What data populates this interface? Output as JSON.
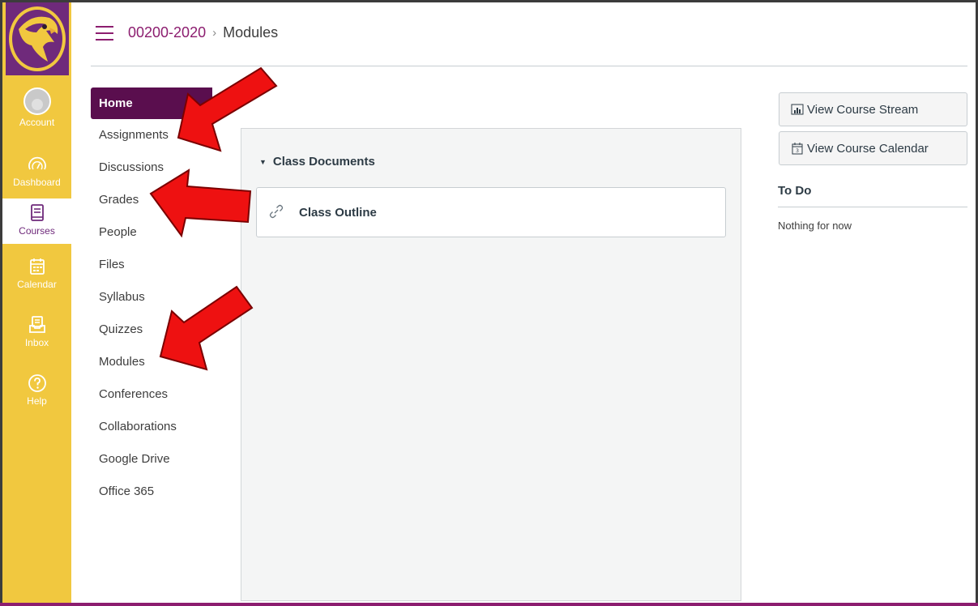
{
  "global_nav": {
    "items": [
      {
        "label": "Account",
        "icon": "avatar"
      },
      {
        "label": "Dashboard",
        "icon": "dashboard-icon"
      },
      {
        "label": "Courses",
        "icon": "courses-icon"
      },
      {
        "label": "Calendar",
        "icon": "calendar-icon"
      },
      {
        "label": "Inbox",
        "icon": "inbox-icon"
      },
      {
        "label": "Help",
        "icon": "help-icon"
      }
    ],
    "active": "Courses"
  },
  "header": {
    "course": "00200-2020",
    "separator": "›",
    "current": "Modules"
  },
  "course_nav": {
    "items": [
      "Home",
      "Assignments",
      "Discussions",
      "Grades",
      "People",
      "Files",
      "Syllabus",
      "Quizzes",
      "Modules",
      "Conferences",
      "Collaborations",
      "Google Drive",
      "Office 365"
    ],
    "active": "Home"
  },
  "module": {
    "title": "Class Documents",
    "items": [
      {
        "title": "Class Outline",
        "icon": "link-icon"
      }
    ]
  },
  "sidebar": {
    "view_stream": "View Course Stream",
    "view_calendar": "View Course Calendar",
    "todo_title": "To Do",
    "todo_empty": "Nothing for now"
  },
  "colors": {
    "nav_bg": "#f1c83f",
    "brand": "#8c1d6f",
    "active_nav": "#5a0e4e",
    "arrow": "#ee1111"
  }
}
